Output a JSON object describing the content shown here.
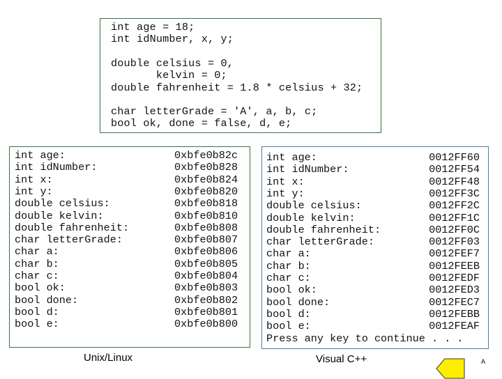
{
  "code_box": {
    "lines": [
      "int age = 18;",
      "int idNumber, x, y;",
      "",
      "double celsius = 0,",
      "       kelvin = 0;",
      "double fahrenheit = 1.8 * celsius + 32;",
      "",
      "char letterGrade = 'A', a, b, c;",
      "bool ok, done = false, d, e;"
    ]
  },
  "unix_output": {
    "caption": "Unix/Linux",
    "rows": [
      {
        "label": "int age:",
        "address": "0xbfe0b82c"
      },
      {
        "label": "int idNumber:",
        "address": "0xbfe0b828"
      },
      {
        "label": "int x:",
        "address": "0xbfe0b824"
      },
      {
        "label": "int y:",
        "address": "0xbfe0b820"
      },
      {
        "label": "double celsius:",
        "address": "0xbfe0b818"
      },
      {
        "label": "double kelvin:",
        "address": "0xbfe0b810"
      },
      {
        "label": "double fahrenheit:",
        "address": "0xbfe0b808"
      },
      {
        "label": "char letterGrade:",
        "address": "0xbfe0b807"
      },
      {
        "label": "char a:",
        "address": "0xbfe0b806"
      },
      {
        "label": "char b:",
        "address": "0xbfe0b805"
      },
      {
        "label": "char c:",
        "address": "0xbfe0b804"
      },
      {
        "label": "bool ok:",
        "address": "0xbfe0b803"
      },
      {
        "label": "bool done:",
        "address": "0xbfe0b802"
      },
      {
        "label": "bool d:",
        "address": "0xbfe0b801"
      },
      {
        "label": "bool e:",
        "address": "0xbfe0b800"
      }
    ]
  },
  "vc_output": {
    "caption": "Visual C++",
    "rows": [
      {
        "label": "int age:",
        "address": "0012FF60"
      },
      {
        "label": "int idNumber:",
        "address": "0012FF54"
      },
      {
        "label": "int x:",
        "address": "0012FF48"
      },
      {
        "label": "int y:",
        "address": "0012FF3C"
      },
      {
        "label": "double celsius:",
        "address": "0012FF2C"
      },
      {
        "label": "double kelvin:",
        "address": "0012FF1C"
      },
      {
        "label": "double fahrenheit:",
        "address": "0012FF0C"
      },
      {
        "label": "char letterGrade:",
        "address": "0012FF03"
      },
      {
        "label": "char a:",
        "address": "0012FEF7"
      },
      {
        "label": "char b:",
        "address": "0012FEEB"
      },
      {
        "label": "char c:",
        "address": "0012FEDF"
      },
      {
        "label": "bool ok:",
        "address": "0012FED3"
      },
      {
        "label": "bool done:",
        "address": "0012FEC7"
      },
      {
        "label": "bool d:",
        "address": "0012FEBB"
      },
      {
        "label": "bool e:",
        "address": "0012FEAF"
      }
    ],
    "prompt": "Press any key to continue . . ."
  },
  "nav": {
    "back_arrow_icon": "left-arrow-icon",
    "arrow_color": "#ffee00",
    "corner_label": "A"
  }
}
